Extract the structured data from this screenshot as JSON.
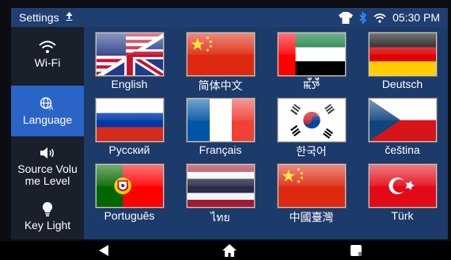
{
  "status_bar": {
    "title": "Settings",
    "upload_icon": "upload-arrow-icon",
    "icons": [
      "tshirt-icon",
      "bluetooth-icon",
      "wifi-icon"
    ],
    "time": "05:30 PM"
  },
  "sidebar": {
    "items": [
      {
        "label": "Wi-Fi",
        "icon": "wifi-icon"
      },
      {
        "label": "Language",
        "icon": "globe-language-icon",
        "active": true
      },
      {
        "label": "Source Volu me Level",
        "icon": "speaker-volume-icon"
      },
      {
        "label": "Key Light",
        "icon": "lightbulb-icon"
      }
    ]
  },
  "languages": [
    {
      "label": "English",
      "flag": "uk-usa-flag"
    },
    {
      "label": "简体中文",
      "flag": "china-flag"
    },
    {
      "label": "ꯃꯩꯇꯩ",
      "flag": "uae-flag"
    },
    {
      "label": "Deutsch",
      "flag": "germany-flag"
    },
    {
      "label": "Русский",
      "flag": "russia-flag"
    },
    {
      "label": "Français",
      "flag": "france-flag"
    },
    {
      "label": "한국어",
      "flag": "south-korea-flag"
    },
    {
      "label": "čeština",
      "flag": "czech-flag"
    },
    {
      "label": "Português",
      "flag": "portugal-flag"
    },
    {
      "label": "ไทย",
      "flag": "thailand-flag"
    },
    {
      "label": "中國臺灣",
      "flag": "china-flag"
    },
    {
      "label": "Türk",
      "flag": "turkey-flag"
    }
  ],
  "nav_bar": {
    "back_icon": "back-triangle-icon",
    "home_icon": "home-icon",
    "recents_icon": "recents-square-icon"
  },
  "colors": {
    "status_bar_bg": "#1f3f71",
    "content_bg": "#1c3a6a",
    "sidebar_bg": "#1a1f2c",
    "sidebar_active": "#2a64c6"
  }
}
